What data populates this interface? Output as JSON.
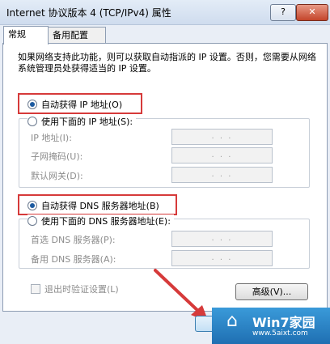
{
  "window": {
    "title": "Internet 协议版本 4 (TCP/IPv4) 属性",
    "help_label": "?",
    "close_label": "✕"
  },
  "tabs": [
    {
      "label": "常规"
    },
    {
      "label": "备用配置"
    }
  ],
  "description": "如果网络支持此功能，则可以获取自动指派的 IP 设置。否则，您需要从网络系统管理员处获得适当的 IP 设置。",
  "ip": {
    "auto_label": "自动获得 IP 地址(O)",
    "auto_selected": true,
    "manual_label": "使用下面的 IP 地址(S):",
    "fields": [
      {
        "label": "IP 地址(I):",
        "value": ". . ."
      },
      {
        "label": "子网掩码(U):",
        "value": ". . ."
      },
      {
        "label": "默认网关(D):",
        "value": ". . ."
      }
    ]
  },
  "dns": {
    "auto_label": "自动获得 DNS 服务器地址(B)",
    "auto_selected": true,
    "manual_label": "使用下面的 DNS 服务器地址(E):",
    "fields": [
      {
        "label": "首选 DNS 服务器(P):",
        "value": ". . ."
      },
      {
        "label": "备用 DNS 服务器(A):",
        "value": ". . ."
      }
    ]
  },
  "validate_label": "退出时验证设置(L)",
  "advanced_label": "高级(V)...",
  "watermark": {
    "title": "Win7家园",
    "url": "www.5aixt.com",
    "logo": "⌂"
  },
  "colors": {
    "highlight": "#d63a3a",
    "accent": "#1c5aa0"
  }
}
